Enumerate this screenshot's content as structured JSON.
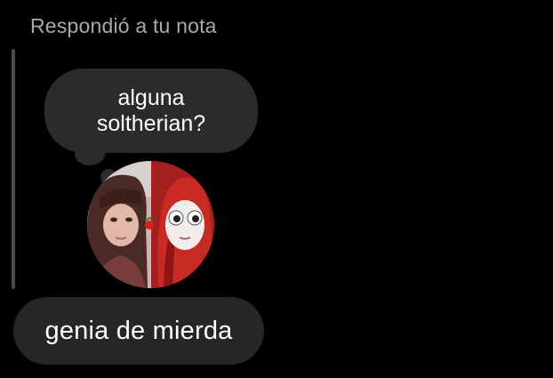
{
  "reply": {
    "header": "Respondió a tu nota"
  },
  "note": {
    "text": "alguna soltherian?",
    "avatar_icon": "profile-avatar"
  },
  "message": {
    "text": "genia de mierda"
  },
  "colors": {
    "background": "#000000",
    "bubble": "#2b2b2b",
    "header_text": "#a9a9a9",
    "text": "#ffffff"
  }
}
